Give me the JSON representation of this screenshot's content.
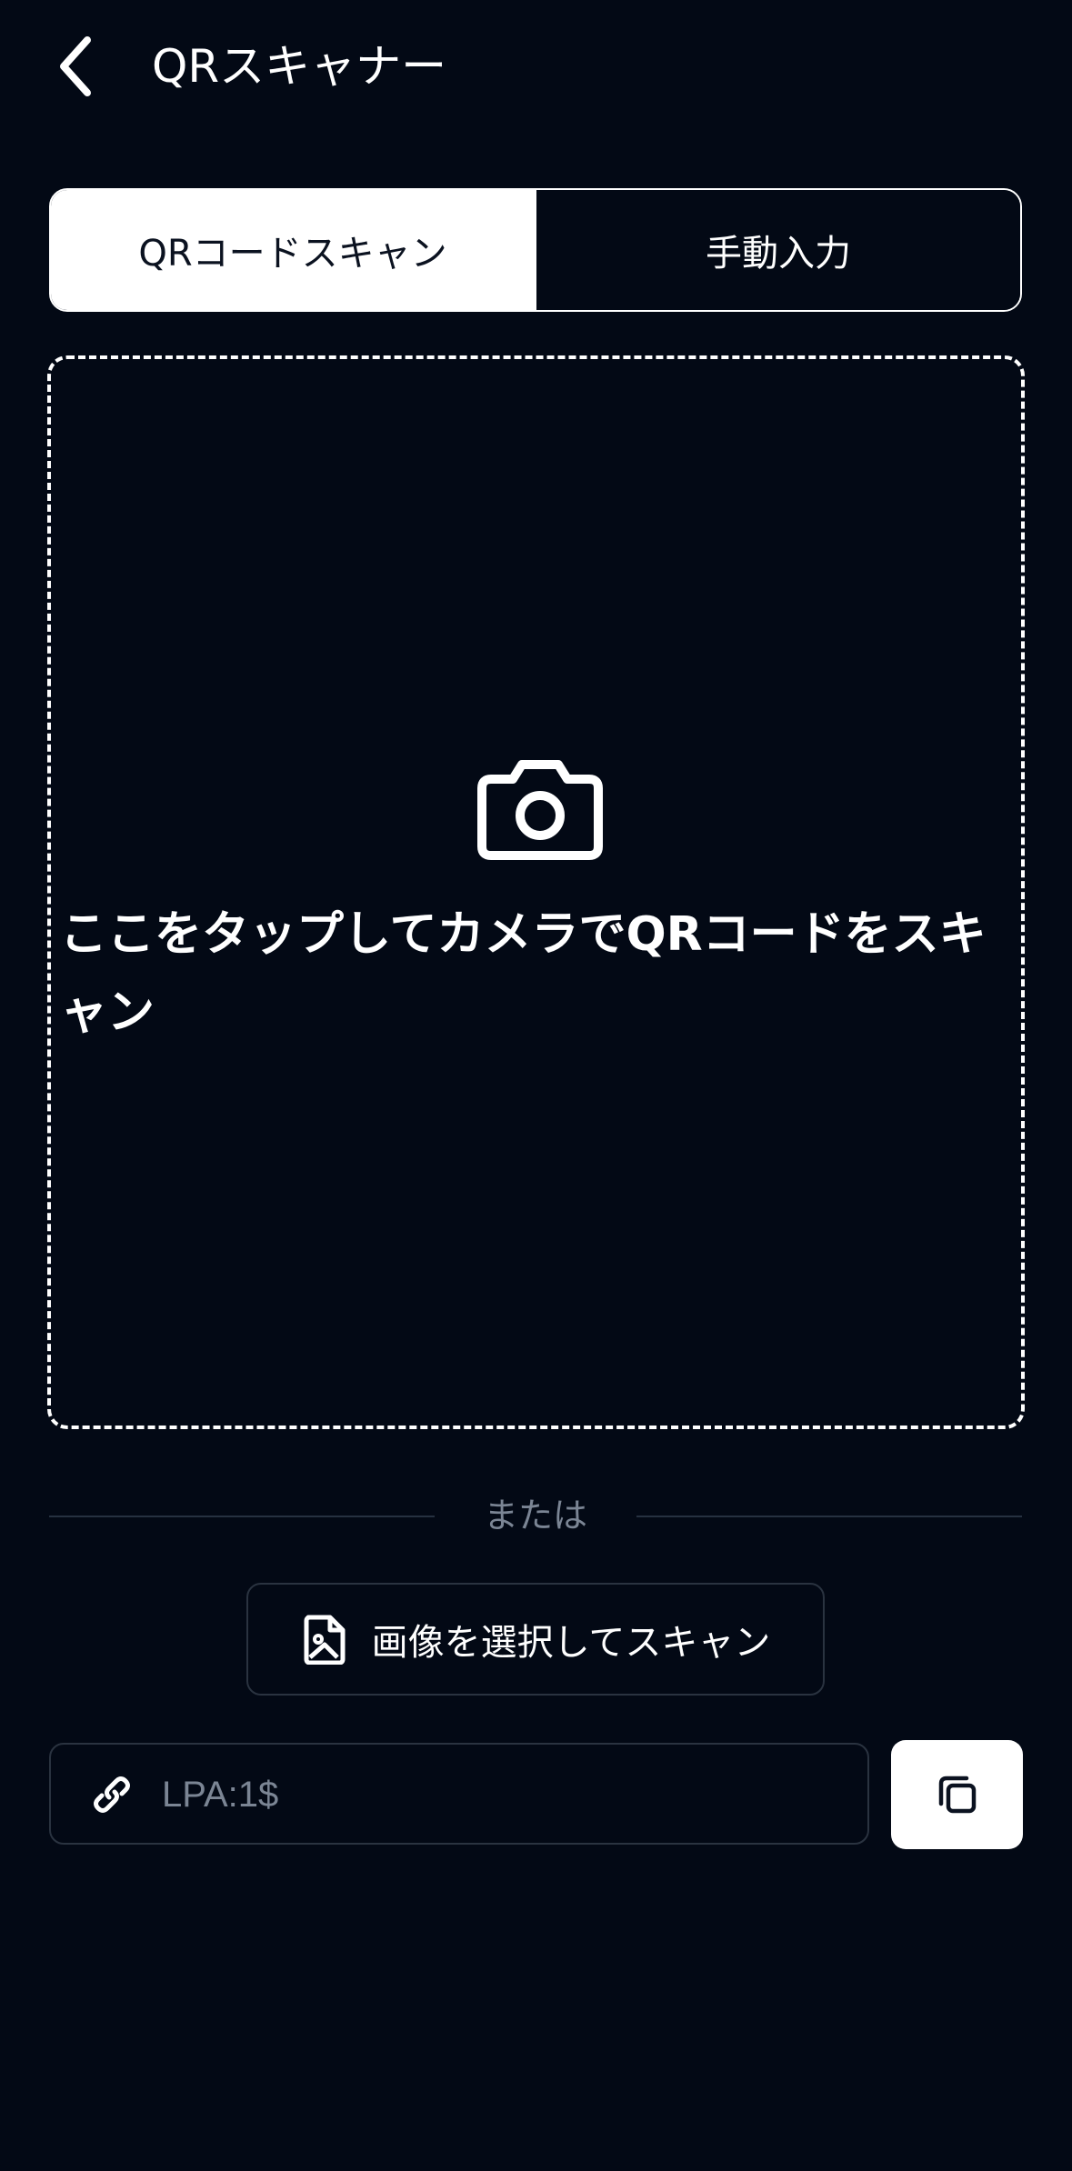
{
  "header": {
    "title": "QRスキャナー",
    "back_icon": "chevron-left-icon"
  },
  "tabs": [
    {
      "label": "QRコードスキャン",
      "active": true
    },
    {
      "label": "手動入力",
      "active": false
    }
  ],
  "scan_area": {
    "icon": "camera-icon",
    "prompt": "ここをタップしてカメラでQRコードをスキャン"
  },
  "separator": {
    "label": "または"
  },
  "select_image": {
    "icon": "image-file-icon",
    "label": "画像を選択してスキャン"
  },
  "lpa_field": {
    "icon": "link-icon",
    "placeholder": "LPA:1$",
    "value": ""
  },
  "copy_button": {
    "icon": "copy-icon"
  },
  "colors": {
    "background": "#030915",
    "text": "#ffffff",
    "muted": "#7b8594",
    "border": "#2a3340"
  }
}
